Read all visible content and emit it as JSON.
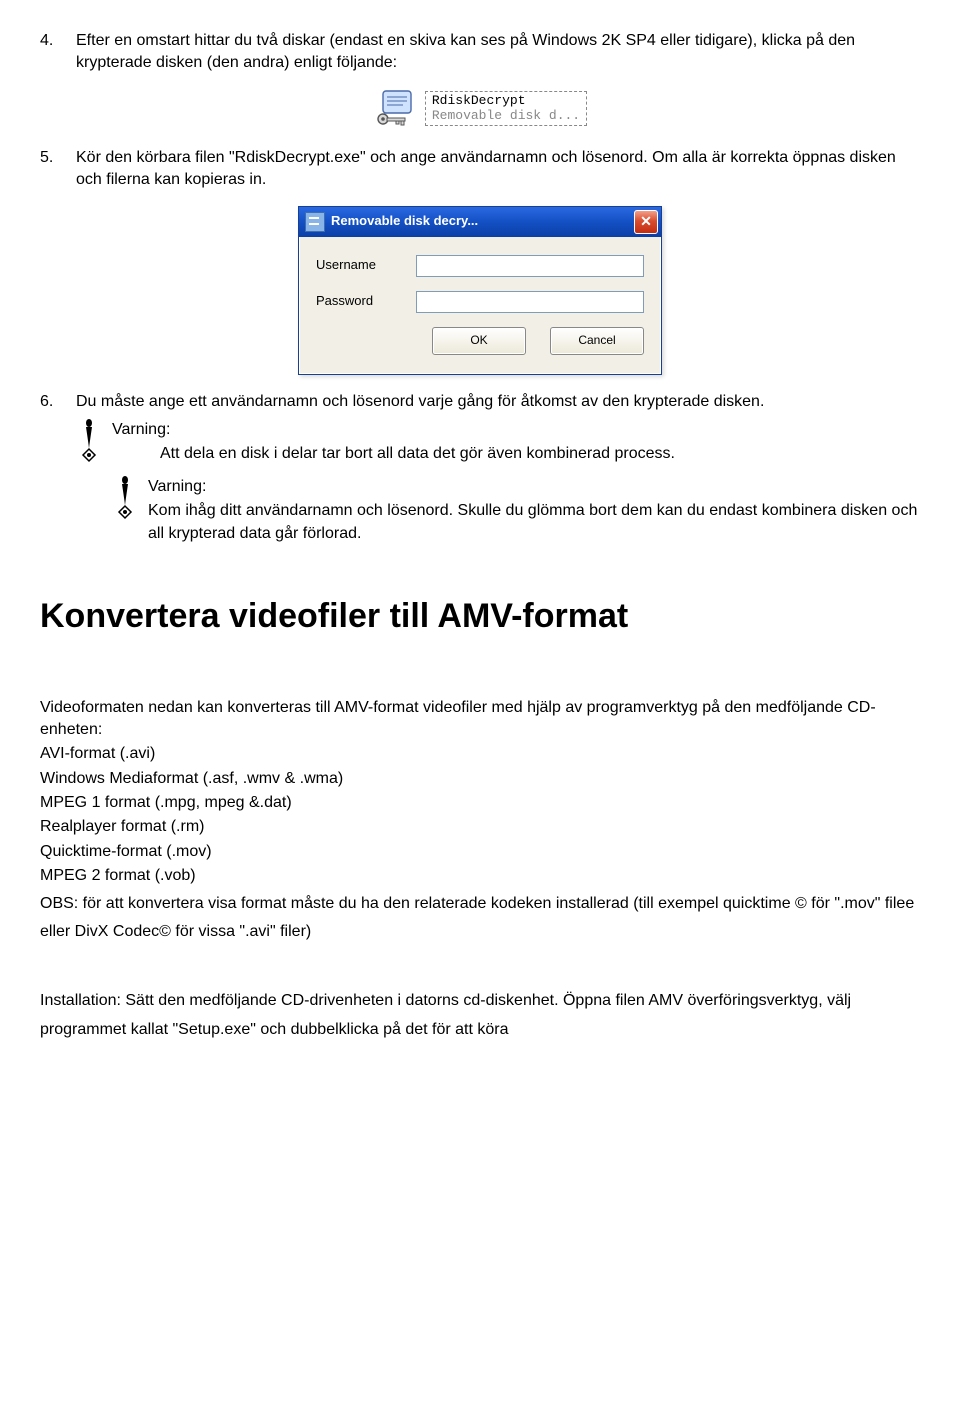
{
  "step4": {
    "num": "4.",
    "text": "Efter en omstart hittar du två diskar (endast en skiva kan ses på Windows 2K SP4 eller tidigare), klicka på den krypterade disken (den andra) enligt följande:"
  },
  "rdisk_icon": {
    "line1": "RdiskDecrypt",
    "line2": "Removable disk d..."
  },
  "step5": {
    "num": "5.",
    "text": "Kör den körbara filen \"RdiskDecrypt.exe\" och ange användarnamn och lösenord. Om alla är korrekta öppnas disken och filerna kan kopieras in."
  },
  "dialog": {
    "title": "Removable disk decry...",
    "username_label": "Username",
    "password_label": "Password",
    "ok_label": "OK",
    "cancel_label": "Cancel"
  },
  "step6": {
    "num": "6.",
    "text": "Du måste ange ett användarnamn och lösenord varje gång för åtkomst av den krypterade disken."
  },
  "warn1": {
    "label": "Varning:",
    "text": "Att dela en disk i delar tar bort all data det gör även kombinerad process."
  },
  "warn2": {
    "label": "Varning:",
    "text": "Kom ihåg ditt användarnamn och lösenord. Skulle du glömma bort dem kan du endast kombinera disken och all krypterad data går förlorad."
  },
  "heading": "Konvertera videofiler till AMV-format",
  "conv": {
    "p1": "Videoformaten nedan kan konverteras till AMV-format videofiler med hjälp av programverktyg på den medföljande CD-enheten:",
    "l1": "AVI-format (.avi)",
    "l2": "Windows Mediaformat (.asf, .wmv & .wma)",
    "l3": "MPEG 1 format (.mpg, mpeg &.dat)",
    "l4": "Realplayer format (.rm)",
    "l5": "Quicktime-format (.mov)",
    "l6": "MPEG 2 format (.vob)",
    "obs": "OBS: för att konvertera visa format måste du ha den relaterade kodeken installerad (till exempel quicktime © för \".mov\" filee eller DivX Codec© för vissa \".avi\" filer)",
    "install": "Installation: Sätt den medföljande CD-drivenheten i datorns cd-diskenhet. Öppna filen AMV överföringsverktyg, välj programmet kallat \"Setup.exe\" och dubbelklicka på det för att köra"
  }
}
